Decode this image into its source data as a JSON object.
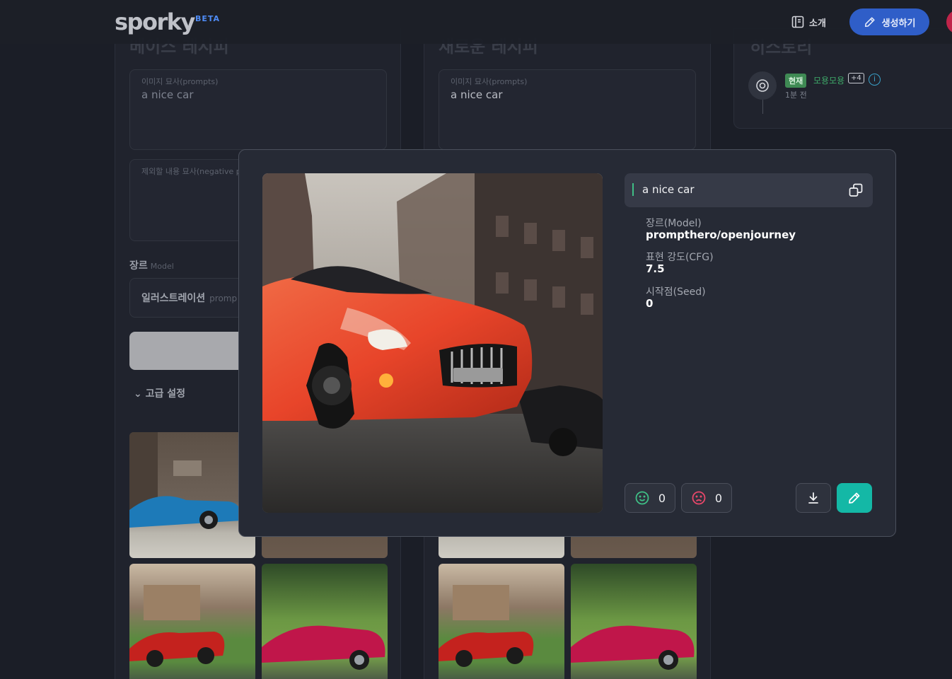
{
  "header": {
    "logo": "sporky",
    "beta": "BETA",
    "about_label": "소개",
    "create_label": "생성하기"
  },
  "panels": [
    {
      "title": "베이스 레시피",
      "prompt_label": "이미지 묘사(prompts)",
      "prompt_value": "a nice car",
      "negative_label": "제외할 내용 묘사(negative p",
      "model_label": "장르",
      "model_label_en": "Model",
      "model_value": "일러스트레이션",
      "model_value_sub": "promp",
      "advanced_label": "고급 설정"
    },
    {
      "title": "새로운 레시피",
      "prompt_label": "이미지 묘사(prompts)",
      "prompt_value": "a nice car"
    }
  ],
  "history": {
    "title": "히스토리",
    "badge": "현재",
    "name": "모용모용",
    "extra": "+4",
    "info": "i",
    "time": "1분 전"
  },
  "modal": {
    "prompt": "a nice car",
    "model_label": "장르(Model)",
    "model_value": "prompthero/openjourney",
    "cfg_label": "표현 강도(CFG)",
    "cfg_value": "7.5",
    "seed_label": "시작점(Seed)",
    "seed_value": "0",
    "likes": "0",
    "dislikes": "0"
  },
  "colors": {
    "accent_blue": "#2f5ec8",
    "accent_teal": "#14b8a6",
    "like_green": "#3fbf86",
    "dislike_red": "#e8476a",
    "car_red": "#e8452a"
  }
}
